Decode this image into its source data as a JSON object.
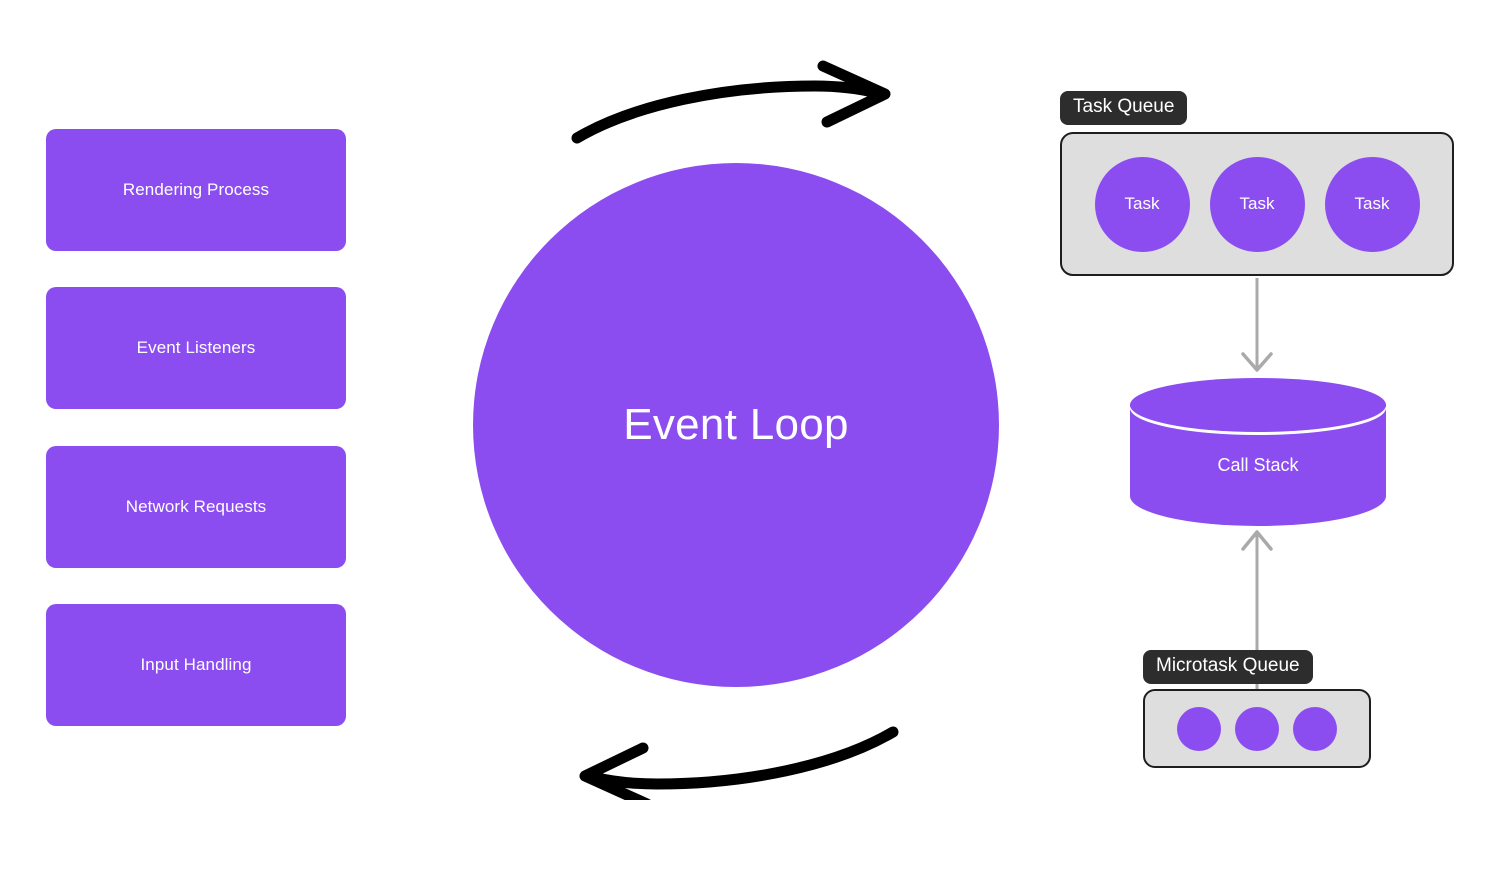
{
  "diagram": {
    "title": "Event Loop",
    "accent_color": "#8c4df0",
    "label_bg_color": "#2d2d2d",
    "queue_bg_color": "#dededf",
    "queue_border_color": "#1e1e1e",
    "connector_color": "#aaaaaa",
    "arrow_color": "#000000"
  },
  "center": {
    "label": "Event Loop"
  },
  "sources": {
    "items": [
      {
        "label": "Rendering Process"
      },
      {
        "label": "Event Listeners"
      },
      {
        "label": "Network Requests"
      },
      {
        "label": "Input Handling"
      }
    ]
  },
  "task_queue": {
    "label": "Task Queue",
    "tasks": [
      {
        "label": "Task"
      },
      {
        "label": "Task"
      },
      {
        "label": "Task"
      }
    ]
  },
  "call_stack": {
    "label": "Call Stack"
  },
  "microtask_queue": {
    "label": "Microtask Queue",
    "dots": [
      {
        "label": ""
      },
      {
        "label": ""
      },
      {
        "label": ""
      }
    ]
  },
  "flow_arrows": {
    "top": "curved-arrow-right",
    "bottom": "curved-arrow-left",
    "task_queue_to_call_stack": "arrow-down",
    "microtask_queue_to_call_stack": "arrow-up"
  }
}
